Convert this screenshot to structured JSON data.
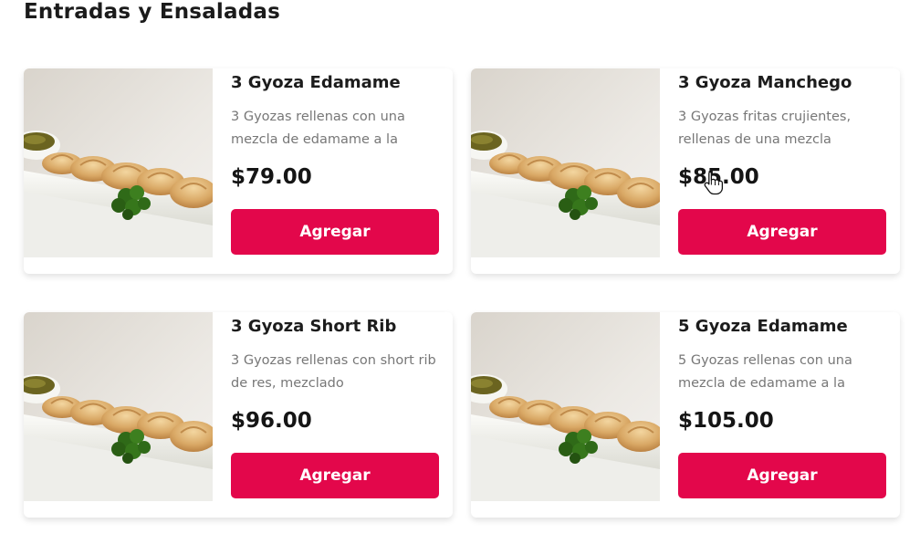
{
  "section": {
    "title": "Entradas y Ensaladas"
  },
  "colors": {
    "accent": "#e3074b",
    "text": "#1c1c1c",
    "muted": "#777777"
  },
  "items": [
    {
      "name": "3 Gyoza Edamame",
      "description": "3 Gyozas rellenas con una mezcla de edamame a la",
      "price": "$79.00",
      "button": "Agregar",
      "image_icon": "gyoza-photo"
    },
    {
      "name": "3 Gyoza Manchego",
      "description": "3 Gyozas fritas crujientes, rellenas de una mezcla",
      "price": "$85.00",
      "button": "Agregar",
      "image_icon": "gyoza-photo"
    },
    {
      "name": "3 Gyoza Short Rib",
      "description": "3 Gyozas rellenas con short rib de res, mezclado",
      "price": "$96.00",
      "button": "Agregar",
      "image_icon": "gyoza-photo"
    },
    {
      "name": "5 Gyoza Edamame",
      "description": "5 Gyozas rellenas con una mezcla de edamame a la",
      "price": "$105.00",
      "button": "Agregar",
      "image_icon": "gyoza-photo"
    }
  ]
}
